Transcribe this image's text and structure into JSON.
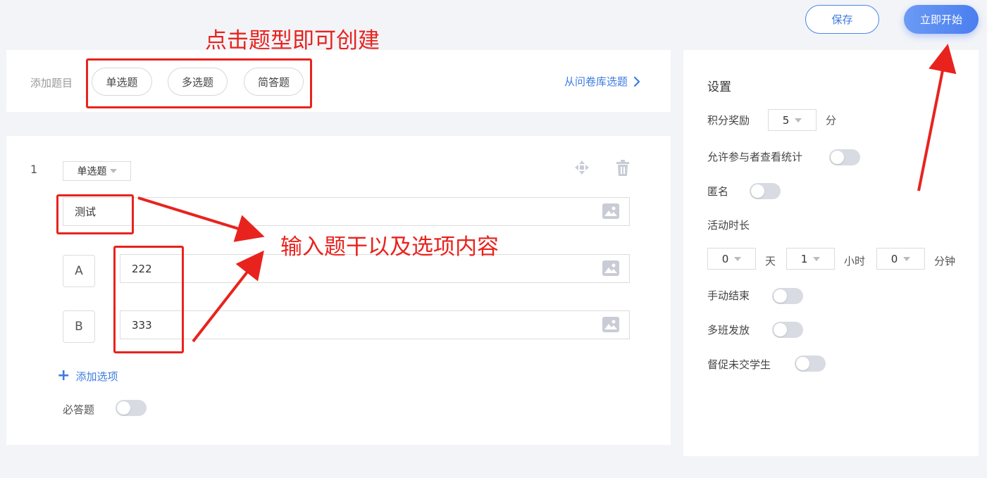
{
  "toolbar": {
    "save_label": "保存",
    "start_label": "立即开始"
  },
  "add_bar": {
    "label": "添加题目",
    "types": [
      "单选题",
      "多选题",
      "简答题"
    ],
    "bank_link": "从问卷库选题"
  },
  "question": {
    "number": "1",
    "type": "单选题",
    "stem": "测试",
    "options": [
      {
        "letter": "A",
        "value": "222"
      },
      {
        "letter": "B",
        "value": "333"
      }
    ],
    "add_option": "添加选项",
    "required_label": "必答题",
    "required": false
  },
  "settings": {
    "title": "设置",
    "points_label": "积分奖励",
    "points_value": "5",
    "points_unit": "分",
    "allow_stats_label": "允许参与者查看统计",
    "anonymous_label": "匿名",
    "duration_label": "活动时长",
    "days_value": "0",
    "days_unit": "天",
    "hours_value": "1",
    "hours_unit": "小时",
    "minutes_value": "0",
    "minutes_unit": "分钟",
    "manual_end_label": "手动结束",
    "multi_class_label": "多班发放",
    "remind_label": "督促未交学生",
    "toggles": {
      "allow_stats": false,
      "anonymous": false,
      "manual_end": false,
      "multi_class": false,
      "remind": false
    }
  },
  "annotations": {
    "top_note": "点击题型即可创建",
    "mid_note": "输入题干以及选项内容",
    "color": "#e8231e"
  },
  "colors": {
    "accent": "#3d7be0",
    "background": "#f3f4f8",
    "toggle_off": "#d8dbe2"
  }
}
